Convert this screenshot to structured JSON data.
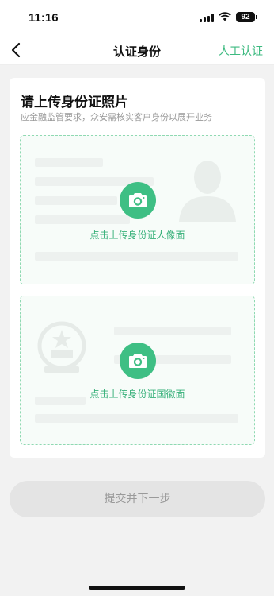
{
  "status": {
    "time": "11:16",
    "battery": "92"
  },
  "nav": {
    "title": "认证身份",
    "right_action": "人工认证"
  },
  "card": {
    "title": "请上传身份证照片",
    "subtitle": "应金融监管要求，众安需核实客户身份以展开业务",
    "front_label": "点击上传身份证人像面",
    "back_label": "点击上传身份证国徽面"
  },
  "submit_label": "提交并下一步",
  "colors": {
    "accent": "#3ebf84",
    "disabled_button": "#e4e4e4"
  },
  "icons": [
    "back-chevron-icon",
    "camera-icon",
    "portrait-silhouette-icon",
    "national-emblem-icon",
    "signal-icon",
    "wifi-icon",
    "battery-icon"
  ]
}
